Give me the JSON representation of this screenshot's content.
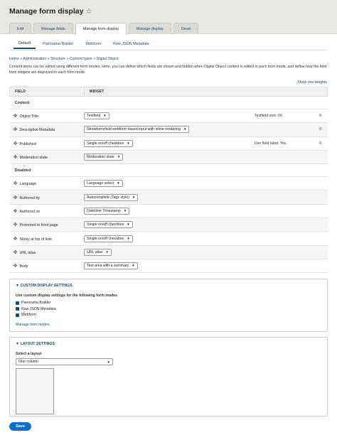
{
  "header": {
    "title": "Manage form display",
    "tabs": [
      {
        "label": "Edit"
      },
      {
        "label": "Manage fields"
      },
      {
        "label": "Manage form display"
      },
      {
        "label": "Manage display"
      },
      {
        "label": "Devel"
      }
    ]
  },
  "subtabs": [
    {
      "label": "Default"
    },
    {
      "label": "Panorama Builder"
    },
    {
      "label": "Webform"
    },
    {
      "label": "Raw JSON Metadata"
    }
  ],
  "breadcrumb": "Home » Administration » Structure » Content types » Digital Object",
  "description": "Content items can be edited using different form modes. Here, you can define which fields are shown and hidden when Digital Object content is edited in each form mode, and define how the field form widgets are displayed in each form mode.",
  "show_row_weights": "Show row weights",
  "table": {
    "col_field": "FIELD",
    "col_widget": "WIDGET",
    "region_content": "Content",
    "region_disabled": "Disabled",
    "content_rows": [
      {
        "name": "Object Title",
        "widget": "Textfield",
        "summary": "Textfield size: 60"
      },
      {
        "name": "Descriptive Metadata",
        "widget": "Strawberryfield webform based input with inline rendering",
        "summary": ""
      },
      {
        "name": "Published",
        "widget": "Single on/off checkbox",
        "summary": "Use field label: Yes"
      },
      {
        "name": "Moderation state",
        "widget": "Moderation state",
        "summary": ""
      }
    ],
    "disabled_rows": [
      {
        "name": "Language",
        "widget": "Language select"
      },
      {
        "name": "Authored by",
        "widget": "Autocomplete (Tags style)"
      },
      {
        "name": "Authored on",
        "widget": "Datetime Timestamp"
      },
      {
        "name": "Promoted to front page",
        "widget": "Single on/off checkbox"
      },
      {
        "name": "Sticky at top of lists",
        "widget": "Single on/off checkbox"
      },
      {
        "name": "URL alias",
        "widget": "URL alias"
      },
      {
        "name": "Body",
        "widget": "Text area with a summary"
      }
    ]
  },
  "custom_display": {
    "legend": "CUSTOM DISPLAY SETTINGS",
    "title": "Use custom display settings for the following form modes",
    "modes": [
      {
        "label": "Panorama Builder"
      },
      {
        "label": "Raw JSON Metadata"
      },
      {
        "label": "Webform"
      }
    ],
    "manage_link": "Manage form modes"
  },
  "layout": {
    "legend": "LAYOUT SETTINGS",
    "select_label": "Select a layout",
    "selected": "One column"
  },
  "save_label": "Save"
}
